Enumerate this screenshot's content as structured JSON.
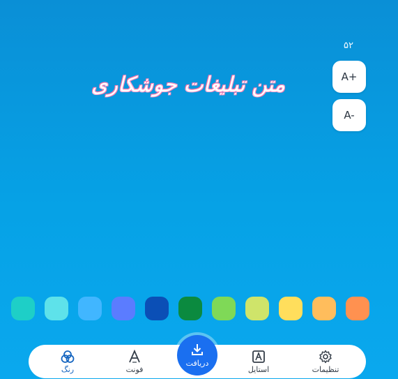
{
  "size": {
    "value": "۵۲",
    "increase_label": "A+",
    "decrease_label": "A-"
  },
  "preview": {
    "text": "متن تبلیغات جوشکاری"
  },
  "palette": [
    "#1ecfc7",
    "#5ee2ea",
    "#41b6ff",
    "#5b7cff",
    "#0b4fb6",
    "#0b8a3f",
    "#7fd957",
    "#cfe46a",
    "#ffde5c",
    "#ffbd5c",
    "#ff9150"
  ],
  "nav": {
    "color": "رنگ",
    "font": "فونت",
    "download": "دریافت",
    "style": "استایل",
    "settings": "تنظیمات"
  },
  "colors": {
    "active": "#1565c0",
    "fab": "#1a6ff0"
  }
}
